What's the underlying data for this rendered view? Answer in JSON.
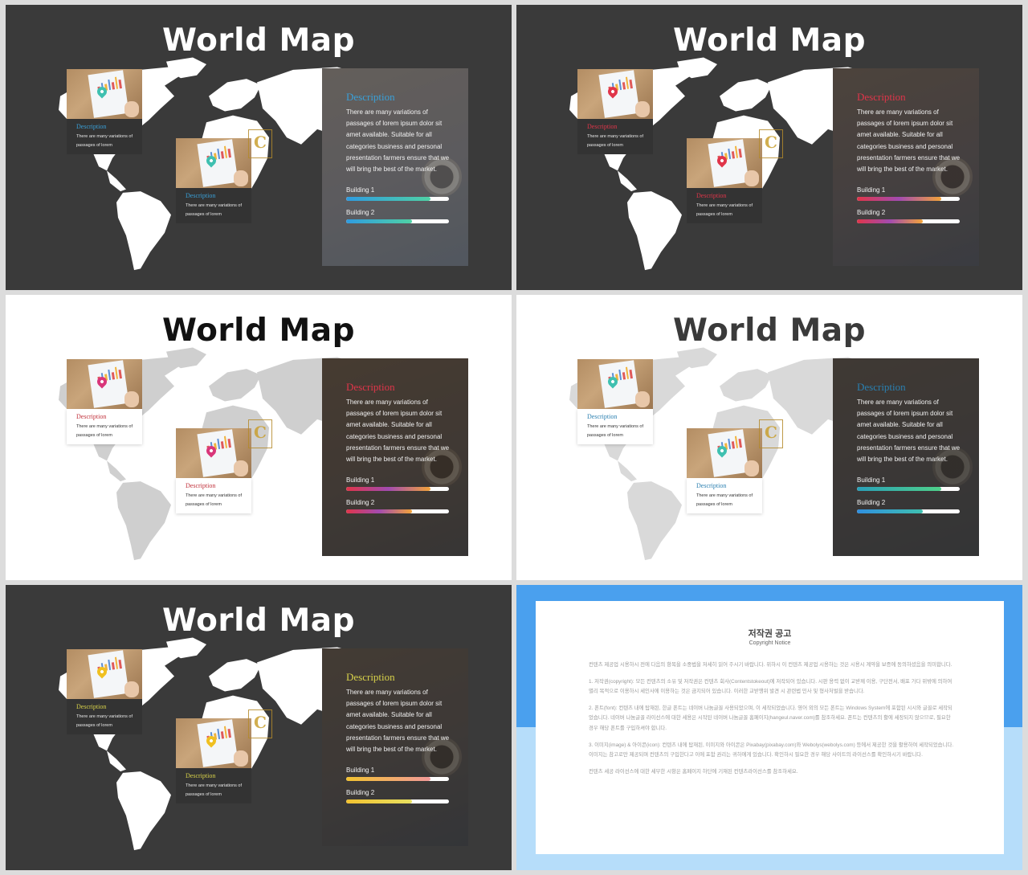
{
  "slides": [
    {
      "title": "World Map",
      "cards": [
        {
          "label": "Description",
          "text": "There are many variations of passages of lorem",
          "label_color": "#3aa0d8",
          "pin_color": "#3fc0b0"
        },
        {
          "label": "Description",
          "text": "There are many variations of passages of lorem",
          "label_color": "#3aa0d8",
          "pin_color": "#3fc0b0"
        }
      ],
      "panel": {
        "title": "Description",
        "title_color": "#3aa0d8",
        "text": "There are many variations of passages of lorem ipsum dolor sit amet available. Suitable for all categories business and personal presentation farmers ensure that we will bring the best of the market.",
        "building1": "Building 1",
        "building2": "Building 2",
        "bar1_gradient": "linear-gradient(90deg,#2f9be0,#4fd1a5)",
        "bar1_progress": 0.82,
        "bar2_gradient": "linear-gradient(90deg,#2f9be0,#4fd1a5)",
        "bar2_progress": 0.64
      }
    },
    {
      "title": "World Map",
      "cards": [
        {
          "label": "Description",
          "text": "There are many variations of passages of lorem",
          "label_color": "#e0354a",
          "pin_color": "#e0354a"
        },
        {
          "label": "Description",
          "text": "There are many variations of passages of lorem",
          "label_color": "#e0354a",
          "pin_color": "#e0354a"
        }
      ],
      "panel": {
        "title": "Description",
        "title_color": "#e0354a",
        "text": "There are many variations of passages of lorem ipsum dolor sit amet available. Suitable for all categories business and personal presentation farmers ensure that we will bring the best of the market.",
        "building1": "Building 1",
        "building2": "Building 2",
        "bar1_gradient": "linear-gradient(90deg,#e0354a,#a24bb0,#f2a33a)",
        "bar1_progress": 0.82,
        "bar2_gradient": "linear-gradient(90deg,#e0354a,#a24bb0,#f2a33a)",
        "bar2_progress": 0.64
      }
    },
    {
      "title": "World Map",
      "cards": [
        {
          "label": "Description",
          "text": "There are many variations of passages of lorem",
          "label_color": "#c0303a",
          "pin_color": "#d9367a"
        },
        {
          "label": "Description",
          "text": "There are many variations of passages of lorem",
          "label_color": "#c0303a",
          "pin_color": "#d9367a"
        }
      ],
      "panel": {
        "title": "Description",
        "title_color": "#e0354a",
        "text": "There are many variations of passages of lorem ipsum dolor sit amet available. Suitable for all categories business and personal presentation farmers ensure that we will bring the best of the market.",
        "building1": "Building 1",
        "building2": "Building 2",
        "bar1_gradient": "linear-gradient(90deg,#e0354a,#a24bb0,#f2a33a)",
        "bar1_progress": 0.82,
        "bar2_gradient": "linear-gradient(90deg,#e0354a,#a24bb0,#f2a33a)",
        "bar2_progress": 0.64
      }
    },
    {
      "title": "World Map",
      "cards": [
        {
          "label": "Description",
          "text": "There are many variations of passages of lorem",
          "label_color": "#2a7fb0",
          "pin_color": "#3fc0b0"
        },
        {
          "label": "Description",
          "text": "There are many variations of passages of lorem",
          "label_color": "#2a7fb0",
          "pin_color": "#3fc0b0"
        }
      ],
      "panel": {
        "title": "Description",
        "title_color": "#2a7fb0",
        "text": "There are many variations of passages of lorem ipsum dolor sit amet available. Suitable for all categories business and personal presentation farmers ensure that we will bring the best of the market.",
        "building1": "Building 1",
        "building2": "Building 2",
        "bar1_gradient": "linear-gradient(90deg,#2aa0b8,#4fd18a)",
        "bar1_progress": 0.82,
        "bar2_gradient": "linear-gradient(90deg,#2f8fe0,#3fc0b0)",
        "bar2_progress": 0.64
      }
    },
    {
      "title": "World Map",
      "cards": [
        {
          "label": "Description",
          "text": "There are many variations of passages of lorem",
          "label_color": "#d8d24a",
          "pin_color": "#f0c020"
        },
        {
          "label": "Description",
          "text": "There are many variations of passages of lorem",
          "label_color": "#d8d24a",
          "pin_color": "#f0c020"
        }
      ],
      "panel": {
        "title": "Description",
        "title_color": "#d8d24a",
        "text": "There are many variations of passages of lorem ipsum dolor sit amet available. Suitable for all categories business and personal presentation farmers ensure that we will bring the best of the market.",
        "building1": "Building 1",
        "building2": "Building 2",
        "bar1_gradient": "linear-gradient(90deg,#f2c230,#f29a9a)",
        "bar1_progress": 0.82,
        "bar2_gradient": "linear-gradient(90deg,#f2c230,#e8e060)",
        "bar2_progress": 0.64
      }
    }
  ],
  "logo_letter": "C",
  "copyright": {
    "title": "저작권 공고",
    "subtitle": "Copyright Notice",
    "p0": "컨텐츠 제공업 시용하시 전에 다음의 항목을 소중법을 저세히 읽어 주시기 바랍니다. 위하시 이 컨텐츠 제공업 시용하는 것은 시용시 계약을 보증에 동의하셨음을 의미합니다.",
    "p1": "1. 저작권(copyright): 모든 컨텐츠의 소유 및 저작권은 컨텐츠 회사(Contentstokeout)에 저작되어 있습니다. 시판 용력 없이 교받께 이용, 구단전서, 배포 가다 위밖에 의하여 별리 목적으로 이용하시 세인사에 이용하는 것은 금지되어 있습니다. 이러한 교받행위 발견 시 관련법 민사 및 형사처벌을 받습니다.",
    "p2": "2. 폰트(font): 컨텐츠 내에 탑재된, 한글 폰트는 네이버 나눔글꼴 사용되었으며, 이 세작되었습니다. 영어 외의 모든 폰트는 Windows System에 포함된 시시와 글꼴로 세작되었습니다. 네이버 나눔글꼴 라이선스에 대한 세용은 시작된 네이버 나눔글꼴 홈페이지(hangeul.naver.com)를 참조하세요. 폰트는 컨텐츠의 활에 세장되지 않으므로, 필요한 경우 해당 폰트를 구입하셔야 합니다.",
    "p3": "3. 이미지(image) & 아이콘(icon): 컨텐츠 내에 탑재된, 이미지와 아이콘은 Pixabay(pixabay.com)와 Webolys(webolys.com) 등에서 제공한 것을 활용하여 세작되었습니다. 이미지는 참고로만 제공되며 컨텐츠의 구입한다고 이에 포함 권리는 귀하에게 있습니다. 확인하시 필요한 경우 해당 사이트의 라이선스를 확인하시기 바랍니다.",
    "p4": "컨텐츠 세공 라이선스에 대한 세부한 시항은 홈페이지 하단에 기재된 컨텐츠라이선스를 참조하세요."
  }
}
